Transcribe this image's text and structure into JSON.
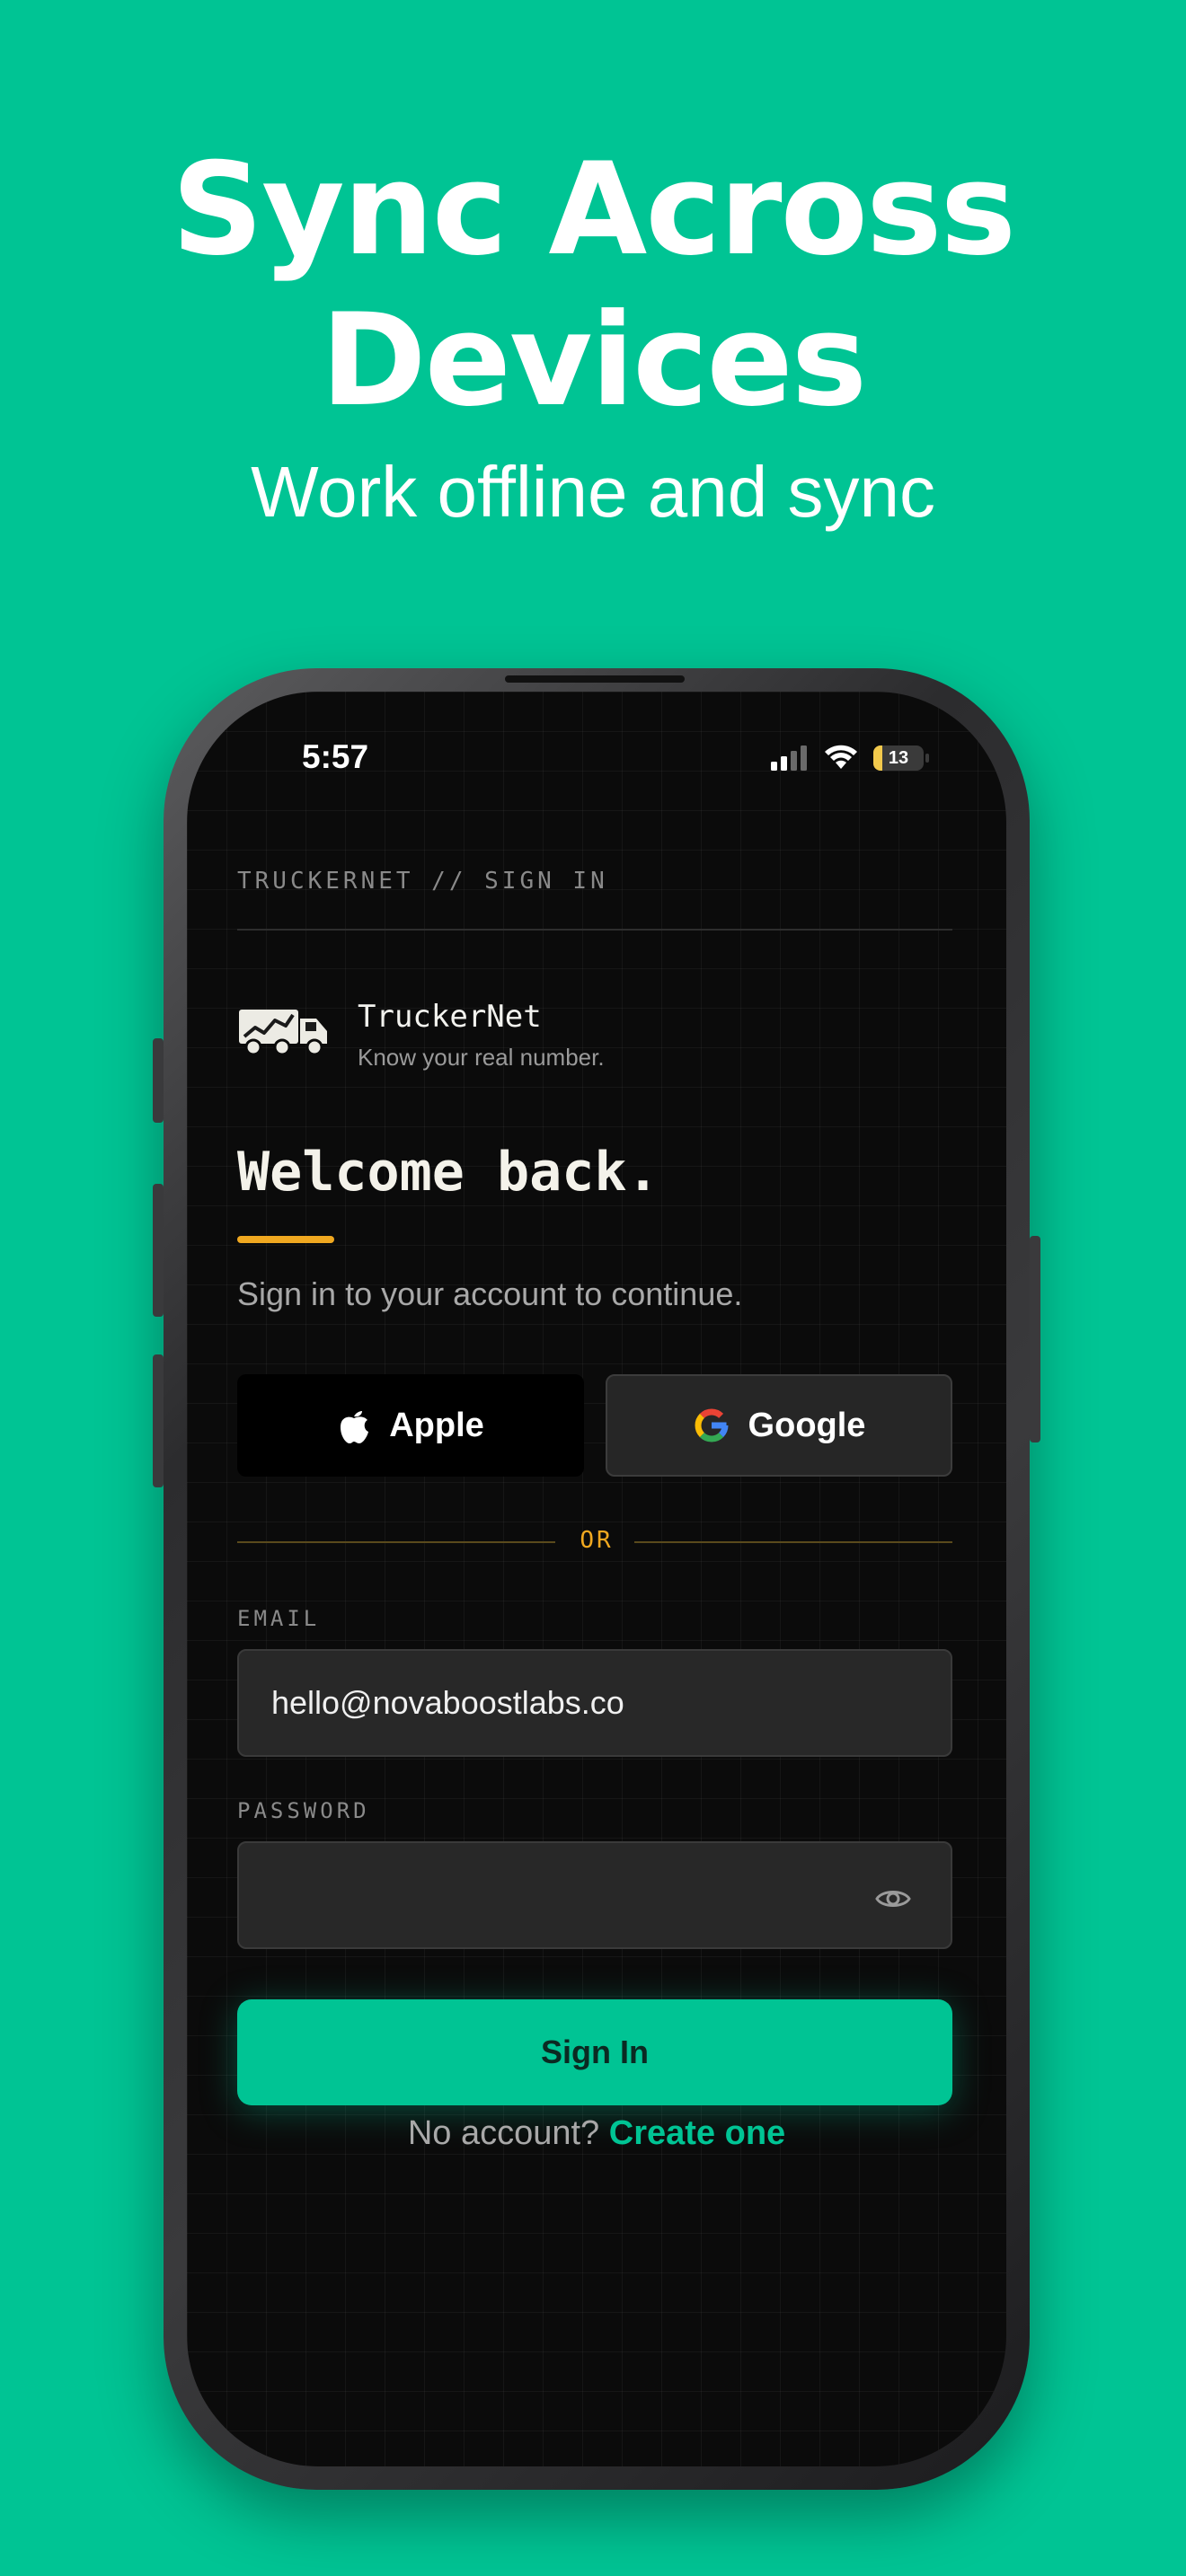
{
  "promo": {
    "headline_line1": "Sync Across",
    "headline_line2": "Devices",
    "subheadline": "Work offline and sync"
  },
  "status_bar": {
    "time": "5:57",
    "battery": "13"
  },
  "screen": {
    "breadcrumb": "TRUCKERNET // SIGN IN",
    "brand_name": "TruckerNet",
    "brand_tagline": "Know your real number.",
    "welcome_title": "Welcome back.",
    "lead": "Sign in to your account to continue.",
    "apple_label": "Apple",
    "google_label": "Google",
    "divider_label": "OR",
    "email_label": "EMAIL",
    "email_value": "hello@novaboostlabs.co",
    "password_label": "PASSWORD",
    "password_value": "",
    "signin_label": "Sign In",
    "no_account_text": "No account?",
    "create_link": "Create one"
  },
  "colors": {
    "background": "#00c494",
    "accent_primary": "#00c494",
    "accent_secondary": "#f0a820",
    "screen_bg": "#0b0b0b"
  },
  "icons": [
    "signal-icon",
    "wifi-icon",
    "battery-icon",
    "truck-logo-icon",
    "apple-icon",
    "google-icon",
    "eye-icon"
  ]
}
